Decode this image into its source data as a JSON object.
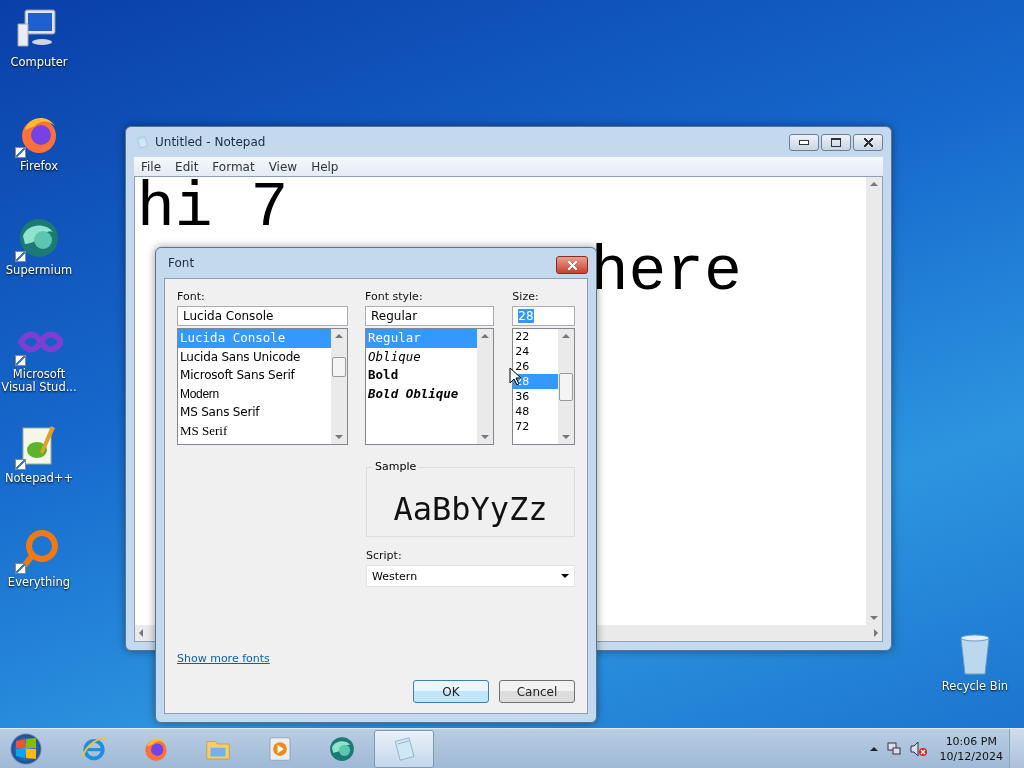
{
  "desktop_icons": [
    {
      "label": "Computer",
      "kind": "computer"
    },
    {
      "label": "Firefox",
      "kind": "firefox"
    },
    {
      "label": "Supermium",
      "kind": "supermium"
    },
    {
      "label": "Microsoft Visual Stud...",
      "kind": "vs"
    },
    {
      "label": "Notepad++",
      "kind": "notepadpp"
    },
    {
      "label": "Everything",
      "kind": "everything"
    }
  ],
  "recycle_bin": {
    "label": "Recycle Bin"
  },
  "notepad": {
    "title": "Untitled - Notepad",
    "menu": [
      "File",
      "Edit",
      "Format",
      "View",
      "Help"
    ],
    "lines": [
      [
        "hi 7"
      ],
      [
        "here"
      ]
    ]
  },
  "font_dialog": {
    "title": "Font",
    "font": {
      "label": "Font:",
      "value": "Lucida Console",
      "items": [
        {
          "text": "Lucida Console",
          "kind": "mono",
          "selected": true
        },
        {
          "text": "Lucida Sans Unicode",
          "kind": "sans",
          "selected": false
        },
        {
          "text": "Microsoft Sans Serif",
          "kind": "sans",
          "selected": false
        },
        {
          "text": "Modern",
          "kind": "narrow",
          "selected": false
        },
        {
          "text": "MS Sans Serif",
          "kind": "sans",
          "selected": false
        },
        {
          "text": "MS Serif",
          "kind": "serif",
          "selected": false
        }
      ]
    },
    "style": {
      "label": "Font style:",
      "value": "Regular",
      "items": [
        {
          "text": "Regular",
          "kind": "regular",
          "selected": true
        },
        {
          "text": "Oblique",
          "kind": "oblique",
          "selected": false
        },
        {
          "text": "Bold",
          "kind": "bold",
          "selected": false
        },
        {
          "text": "Bold Oblique",
          "kind": "bold_oblique",
          "selected": false
        }
      ]
    },
    "size": {
      "label": "Size:",
      "value": "28",
      "items": [
        {
          "text": "22",
          "selected": false
        },
        {
          "text": "24",
          "selected": false
        },
        {
          "text": "26",
          "selected": false
        },
        {
          "text": "28",
          "selected": true
        },
        {
          "text": "36",
          "selected": false
        },
        {
          "text": "48",
          "selected": false
        },
        {
          "text": "72",
          "selected": false
        }
      ]
    },
    "sample": {
      "label": "Sample",
      "text": "AaBbYyZz"
    },
    "script": {
      "label": "Script:",
      "value": "Western"
    },
    "link": "Show more fonts",
    "buttons": [
      {
        "label": "OK",
        "default": true
      },
      {
        "label": "Cancel",
        "default": false
      }
    ]
  },
  "taskbar": {
    "apps": [
      {
        "kind": "ie",
        "active": false
      },
      {
        "kind": "firefox",
        "active": false
      },
      {
        "kind": "explorer",
        "active": false
      },
      {
        "kind": "media",
        "active": false
      },
      {
        "kind": "supermium",
        "active": false
      },
      {
        "kind": "notepad",
        "active": true
      }
    ],
    "clock": {
      "time": "10:06 PM",
      "date": "10/12/2024"
    }
  }
}
